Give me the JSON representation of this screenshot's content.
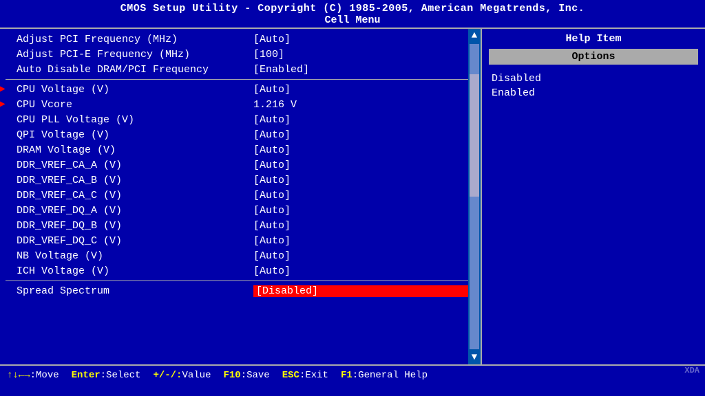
{
  "header": {
    "title": "CMOS Setup Utility - Copyright (C) 1985-2005, American Megatrends, Inc.",
    "subtitle": "Cell Menu"
  },
  "menu_items": [
    {
      "label": "Adjust PCI Frequency (MHz)",
      "value": "[Auto]",
      "selected": false,
      "arrow": false,
      "separator_before": false
    },
    {
      "label": "Adjust PCI-E Frequency (MHz)",
      "value": "[100]",
      "selected": false,
      "arrow": false,
      "separator_before": false
    },
    {
      "label": "Auto Disable DRAM/PCI Frequency",
      "value": "[Enabled]",
      "selected": false,
      "arrow": false,
      "separator_before": false
    },
    {
      "separator": true
    },
    {
      "label": "CPU Voltage (V)",
      "value": "[Auto]",
      "selected": true,
      "arrow": true,
      "separator_before": false
    },
    {
      "label": "CPU Vcore",
      "value": "1.216 V",
      "selected": true,
      "arrow": true,
      "separator_before": false
    },
    {
      "label": "CPU PLL Voltage (V)",
      "value": "[Auto]",
      "selected": false,
      "arrow": false,
      "separator_before": false
    },
    {
      "label": "QPI Voltage (V)",
      "value": "[Auto]",
      "selected": false,
      "arrow": false,
      "separator_before": false
    },
    {
      "label": "DRAM Voltage (V)",
      "value": "[Auto]",
      "selected": false,
      "arrow": false,
      "separator_before": false
    },
    {
      "label": "DDR_VREF_CA_A (V)",
      "value": "[Auto]",
      "selected": false,
      "arrow": false,
      "separator_before": false
    },
    {
      "label": "DDR_VREF_CA_B (V)",
      "value": "[Auto]",
      "selected": false,
      "arrow": false,
      "separator_before": false
    },
    {
      "label": "DDR_VREF_CA_C (V)",
      "value": "[Auto]",
      "selected": false,
      "arrow": false,
      "separator_before": false
    },
    {
      "label": "DDR_VREF_DQ_A (V)",
      "value": "[Auto]",
      "selected": false,
      "arrow": false,
      "separator_before": false
    },
    {
      "label": "DDR_VREF_DQ_B (V)",
      "value": "[Auto]",
      "selected": false,
      "arrow": false,
      "separator_before": false
    },
    {
      "label": "DDR_VREF_DQ_C (V)",
      "value": "[Auto]",
      "selected": false,
      "arrow": false,
      "separator_before": false
    },
    {
      "label": "NB Voltage (V)",
      "value": "[Auto]",
      "selected": false,
      "arrow": false,
      "separator_before": false
    },
    {
      "label": "ICH Voltage (V)",
      "value": "[Auto]",
      "selected": false,
      "arrow": false,
      "separator_before": false
    },
    {
      "separator": true
    },
    {
      "label": "Spread Spectrum",
      "value": "[Disabled]",
      "selected": false,
      "arrow": false,
      "highlighted_value": true,
      "separator_before": false
    }
  ],
  "right_panel": {
    "help_title": "Help Item",
    "options_label": "Options",
    "options": [
      "Disabled",
      "Enabled"
    ]
  },
  "footer": [
    {
      "key": "↑↓←→",
      "desc": ":Move"
    },
    {
      "key": "Enter",
      "desc": ":Select"
    },
    {
      "key": "+/-/:",
      "desc": "Value"
    },
    {
      "key": "F10",
      "desc": ":Save"
    },
    {
      "key": "ESC",
      "desc": ":Exit"
    },
    {
      "key": "F1",
      "desc": ":General Help"
    }
  ],
  "watermark": "XDA"
}
